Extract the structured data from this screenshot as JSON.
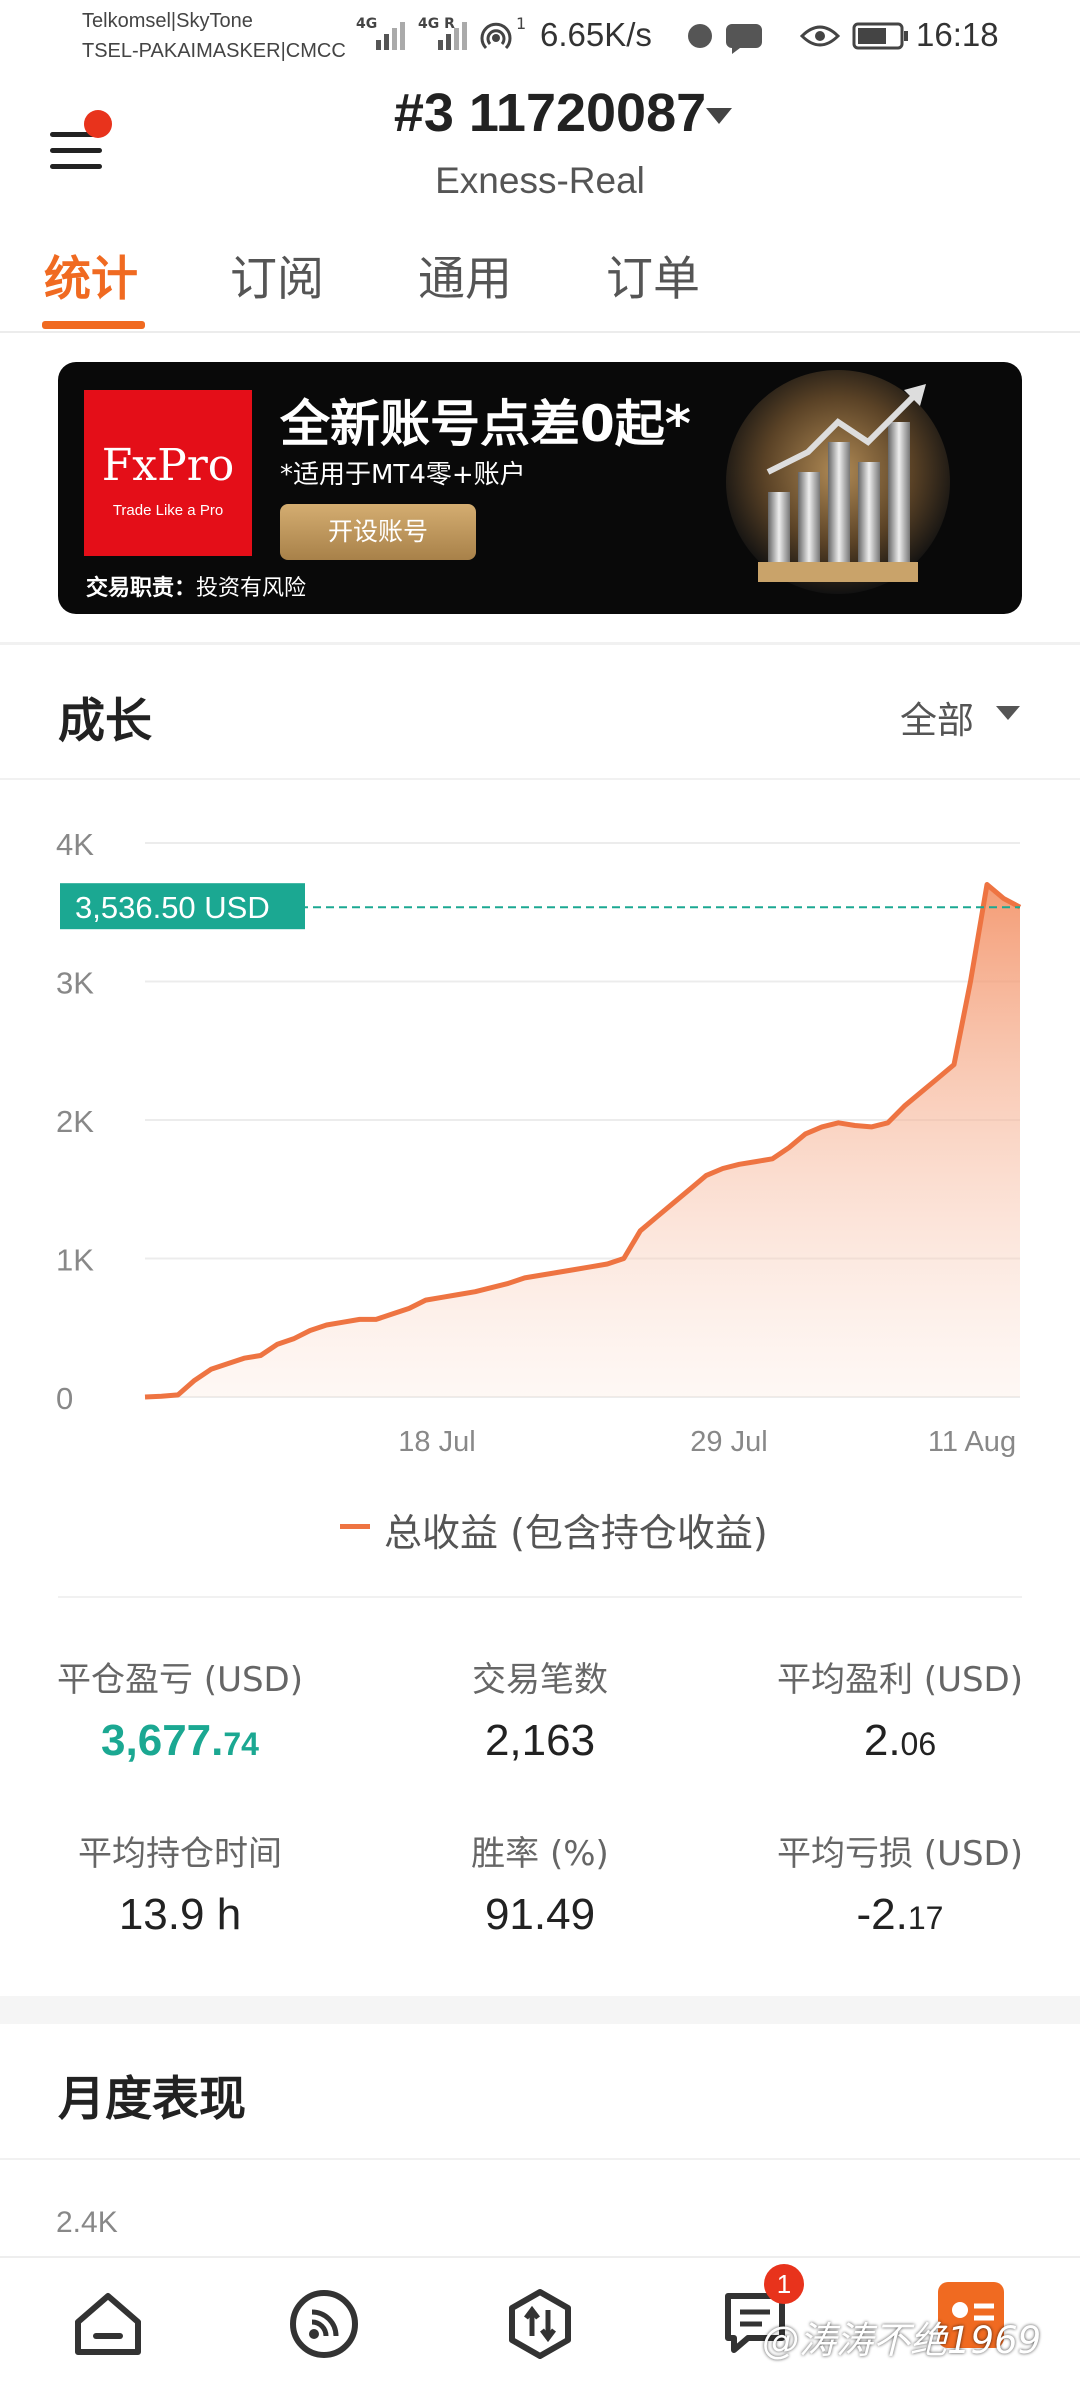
{
  "status_bar": {
    "carrier_line1": "Telkomsel|SkyTone",
    "carrier_line2": "TSEL-PAKAIMASKER|CMCC",
    "net1": "4G",
    "net2": "4G R",
    "hotspot_sup": "1",
    "speed": "6.65K/s",
    "time": "16:18"
  },
  "header": {
    "account_title": "#3  11720087",
    "server": "Exness-Real"
  },
  "tabs": [
    {
      "label": "统计"
    },
    {
      "label": "订阅"
    },
    {
      "label": "通用"
    },
    {
      "label": "订单"
    }
  ],
  "banner": {
    "logo": "FxPro",
    "logo_tagline": "Trade Like a Pro",
    "headline": "全新账号点差0起*",
    "subtext": "*适用于MT4零+账户",
    "button": "开设账号",
    "disclaimer_bold": "交易职责：",
    "disclaimer": "投资有风险"
  },
  "growth": {
    "title": "成长",
    "filter": "全部",
    "current_value_label": "3,536.50 USD",
    "legend": "总收益 (包含持仓收益)"
  },
  "chart_data": {
    "type": "area",
    "series": [
      {
        "name": "总收益 (包含持仓收益)",
        "values": [
          0,
          5,
          15,
          120,
          200,
          240,
          280,
          300,
          380,
          420,
          480,
          520,
          540,
          560,
          560,
          600,
          640,
          700,
          720,
          740,
          760,
          790,
          820,
          860,
          880,
          900,
          920,
          940,
          960,
          1000,
          1200,
          1300,
          1400,
          1500,
          1600,
          1650,
          1680,
          1700,
          1720,
          1800,
          1900,
          1950,
          1980,
          1960,
          1950,
          1980,
          2100,
          2200,
          2300,
          2400,
          3000,
          3700,
          3600,
          3536.5
        ]
      }
    ],
    "x_ticks": [
      "18 Jul",
      "29 Jul",
      "11 Aug"
    ],
    "y_ticks": [
      "0",
      "1K",
      "2K",
      "3K",
      "4K"
    ],
    "ylim": [
      0,
      4000
    ],
    "current_value": 3536.5,
    "colors": {
      "line": "#ee7442",
      "marker_line": "#1ba892",
      "label_bg": "#1ba892"
    }
  },
  "stats": [
    {
      "label": "平仓盈亏 (USD)",
      "int": "3,677.",
      "dec": "74"
    },
    {
      "label": "交易笔数",
      "int": "2,163",
      "dec": ""
    },
    {
      "label": "平均盈利 (USD)",
      "int": "2.",
      "dec": "06"
    },
    {
      "label": "平均持仓时间",
      "int": "13.9 h",
      "dec": ""
    },
    {
      "label": "胜率 (%)",
      "int": "91.49",
      "dec": ""
    },
    {
      "label": "平均亏损 (USD)",
      "int": "-2.",
      "dec": "17"
    }
  ],
  "monthly": {
    "title": "月度表现",
    "y_top": "2.4K"
  },
  "bottom_nav": {
    "badge": "1",
    "watermark": "@涛涛不绝1969"
  },
  "colors": {
    "accent": "#f06a21",
    "green": "#1ba892",
    "banner_red": "#e40e18"
  }
}
